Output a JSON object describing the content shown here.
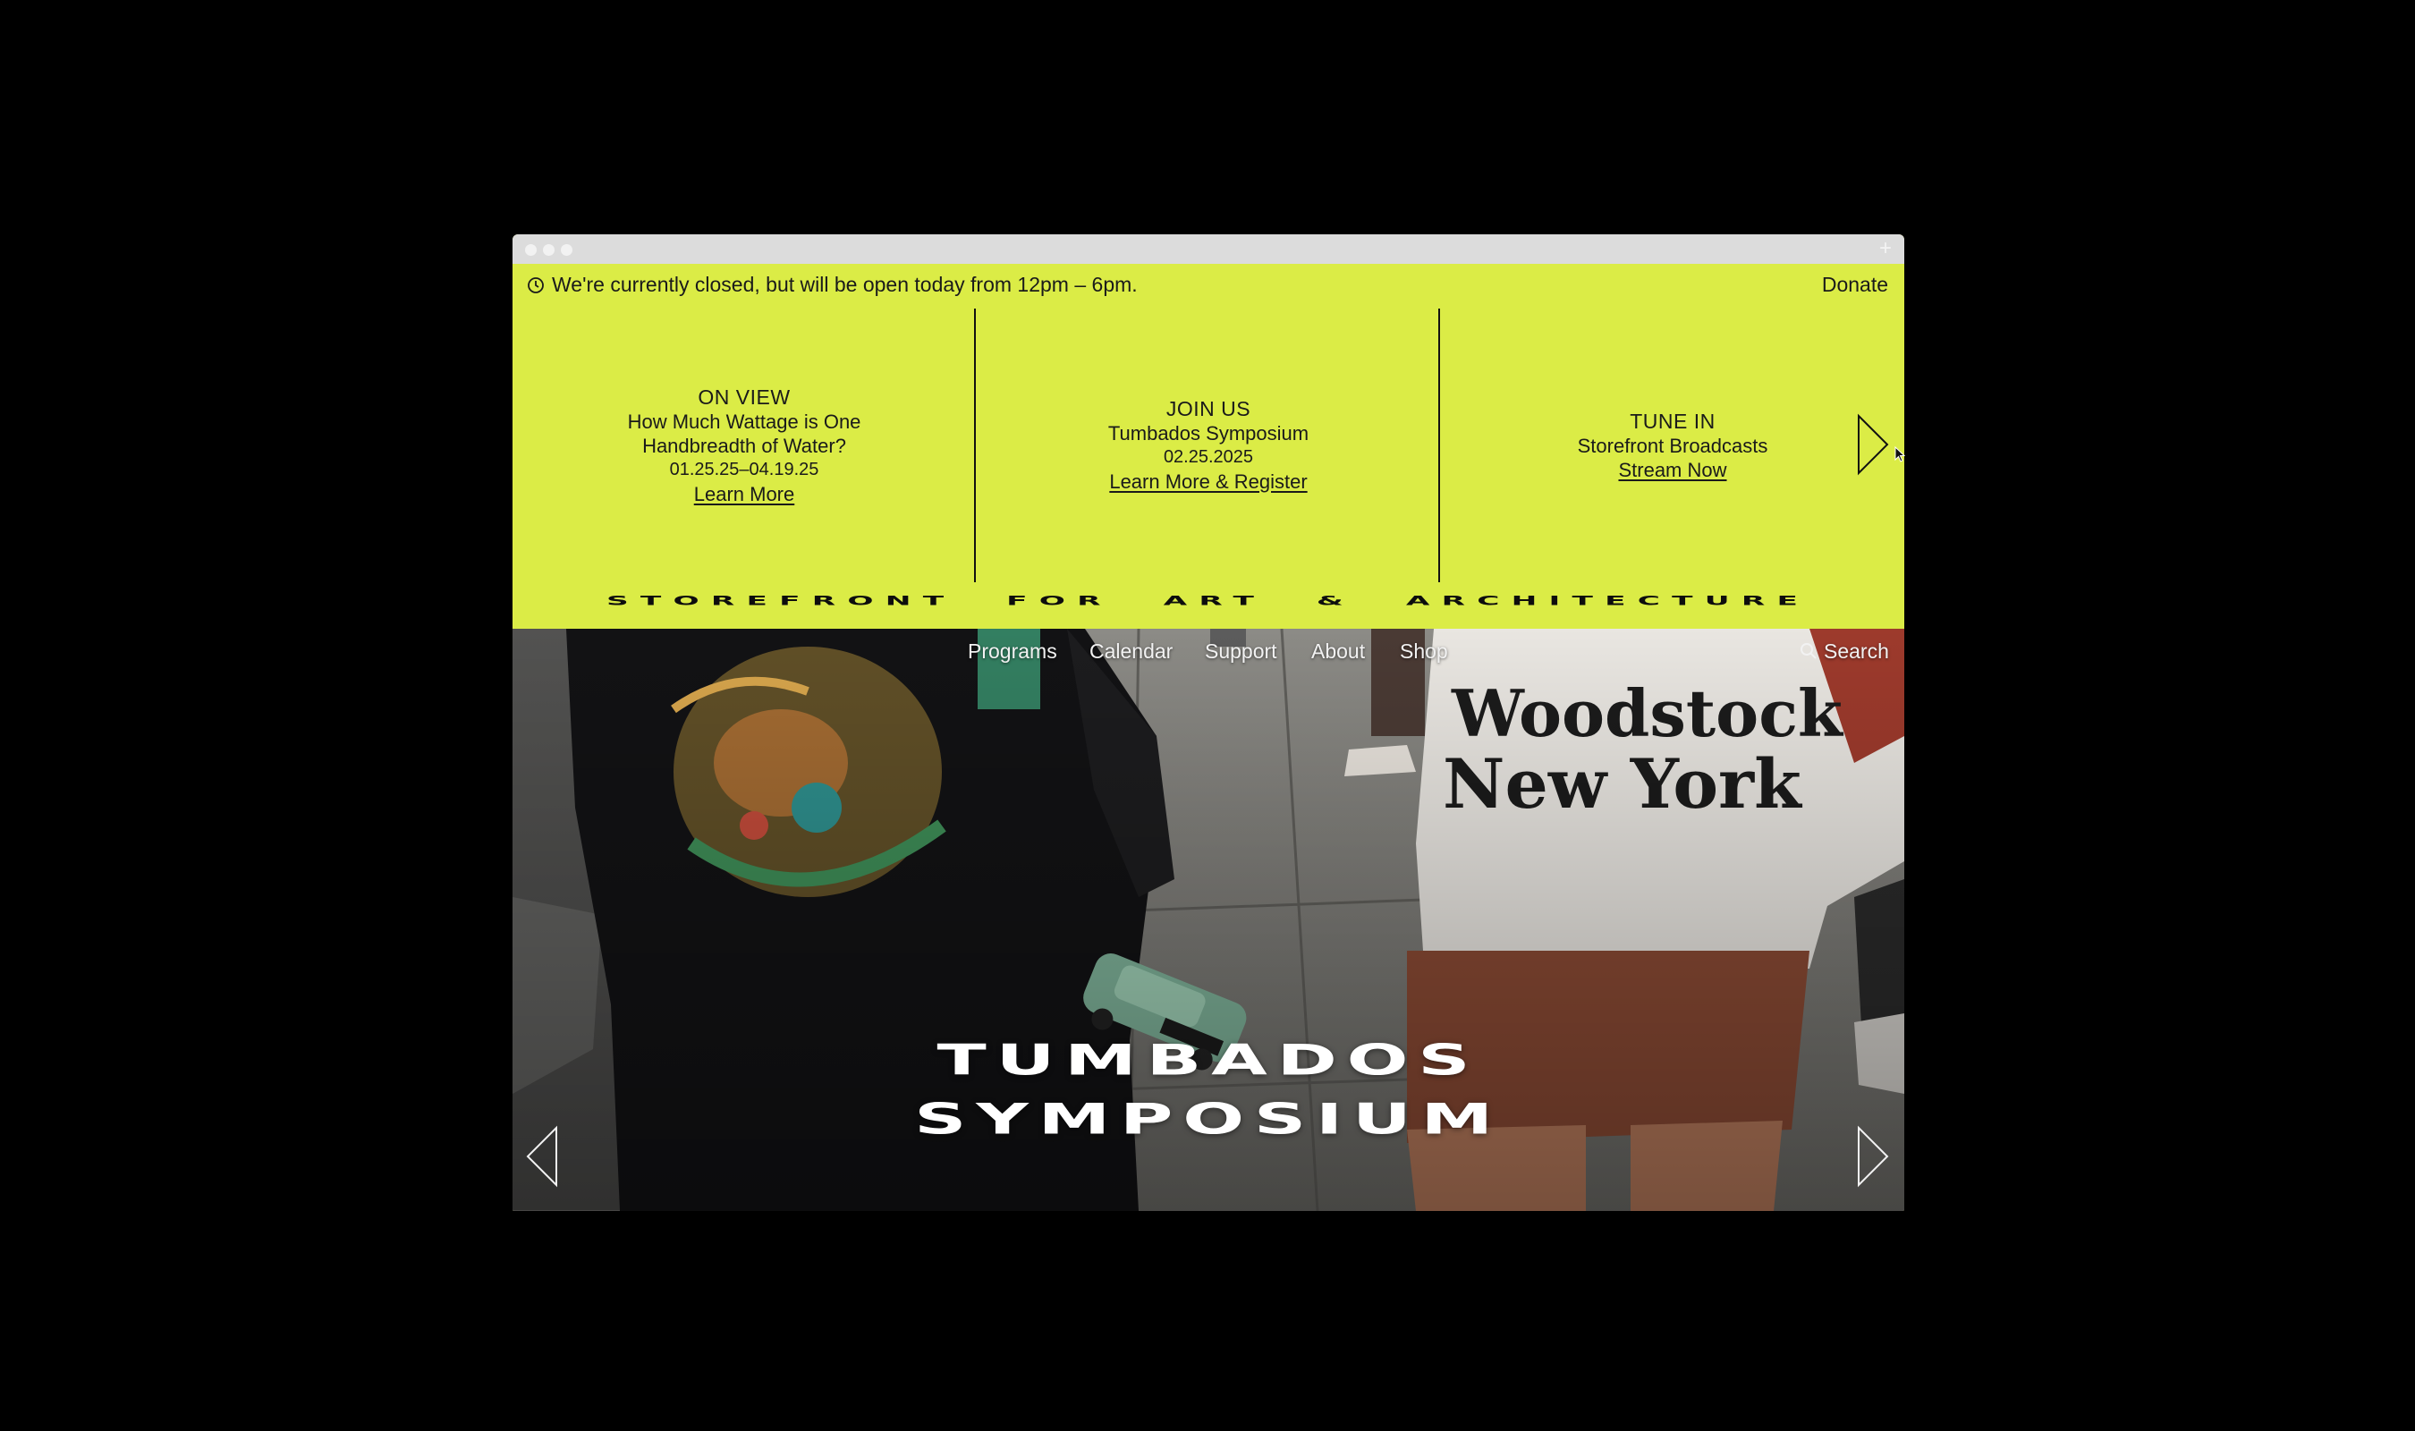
{
  "status": {
    "text": "We're currently closed, but will be open today from 12pm – 6pm.",
    "icon": "clock-icon"
  },
  "donate_label": "Donate",
  "promo": [
    {
      "kicker": "ON VIEW",
      "title": "How Much Wattage is One Handbreadth of Water?",
      "date": "01.25.25–04.19.25",
      "link": "Learn More"
    },
    {
      "kicker": "JOIN US",
      "title": "Tumbados Symposium",
      "date": "02.25.2025",
      "link": "Learn More & Register"
    },
    {
      "kicker": "TUNE IN",
      "title": "Storefront Broadcasts",
      "date": "",
      "link": "Stream Now"
    }
  ],
  "wordmark": "STOREFRONT FOR ART & ARCHITECTURE",
  "nav": {
    "items": [
      "Programs",
      "Calendar",
      "Support",
      "About",
      "Shop"
    ],
    "search_label": "Search"
  },
  "hero": {
    "title_line1": "TUMBADOS",
    "title_line2": "SYMPOSIUM"
  },
  "colors": {
    "accent": "#dbec46",
    "background": "#000000",
    "text": "#1a1a1a"
  }
}
